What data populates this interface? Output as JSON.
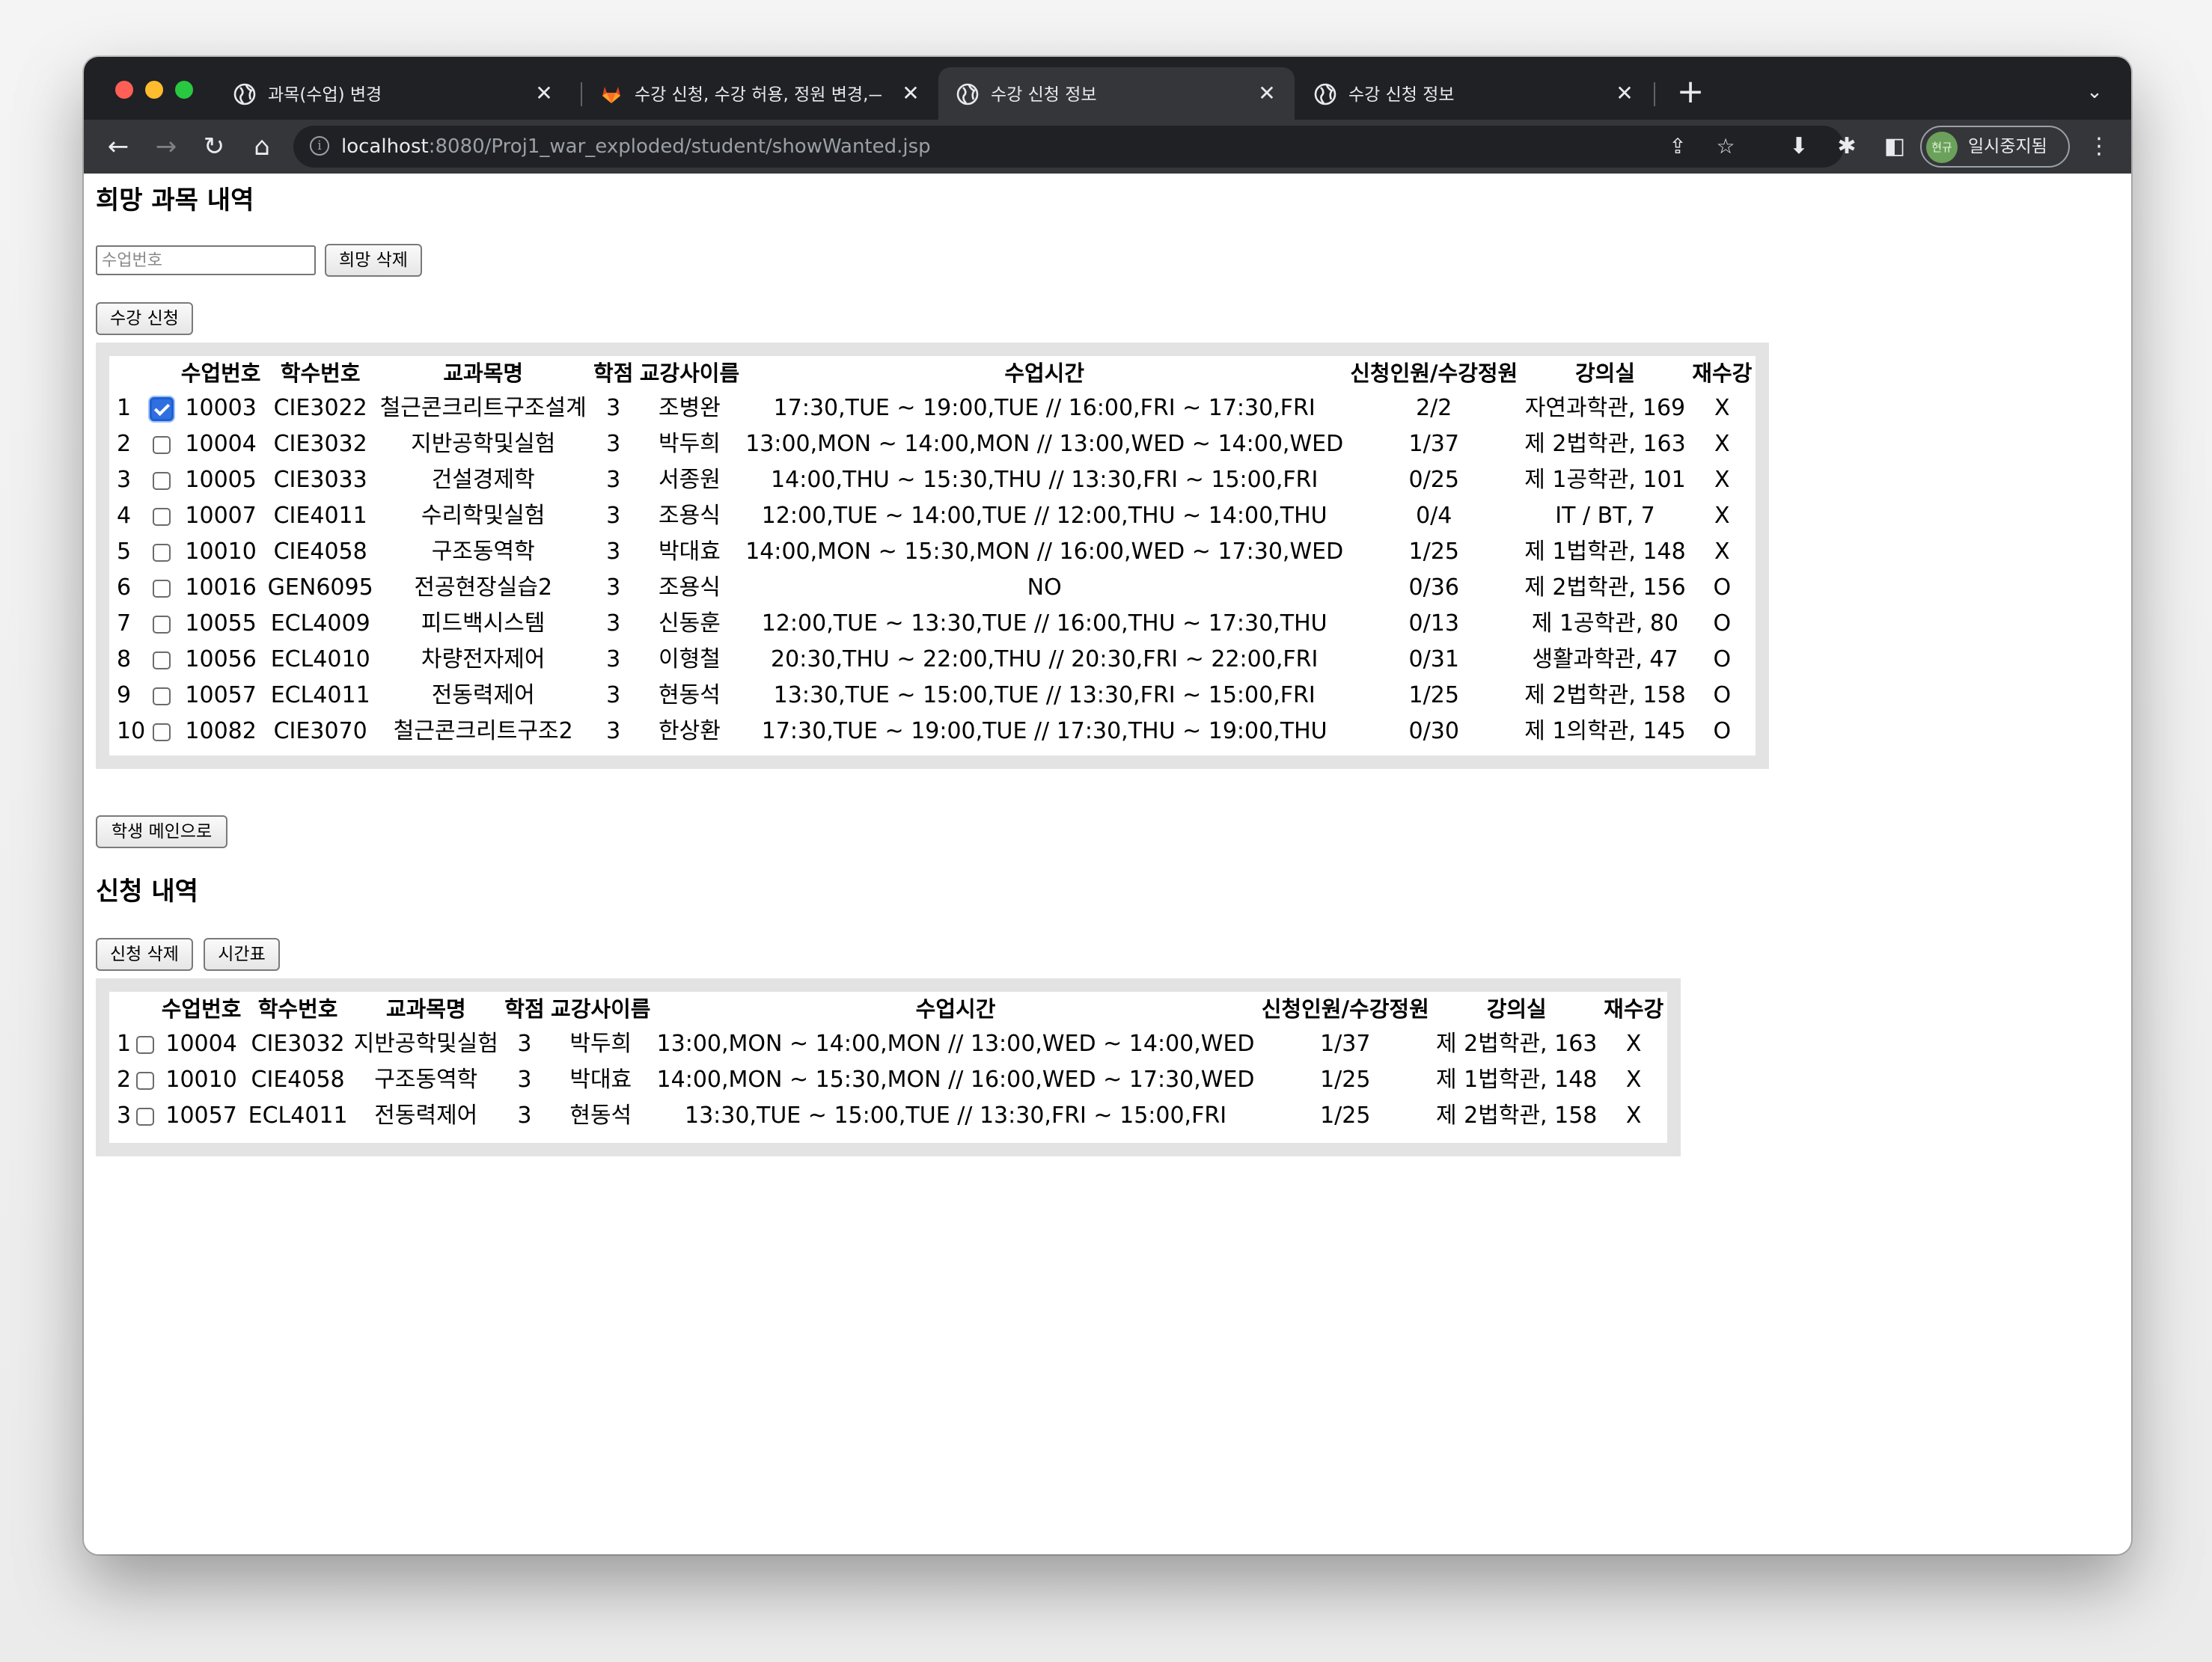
{
  "browser": {
    "tabs": [
      {
        "title": "과목(수업) 변경",
        "icon": "globe-icon",
        "active": false
      },
      {
        "title": "수강 신청, 수강 허용, 정원 변경,— 최",
        "icon": "gitlab-icon",
        "active": false
      },
      {
        "title": "수강 신청 정보",
        "icon": "globe-icon",
        "active": true
      },
      {
        "title": "수강 신청 정보",
        "icon": "globe-icon",
        "active": false
      }
    ],
    "close_glyph": "✕",
    "new_tab_glyph": "+",
    "tab_menu_glyph": "⌄",
    "url_host": "localhost",
    "url_path": ":8080/Proj1_war_exploded/student/showWanted.jsp",
    "profile_avatar_text": "현규",
    "profile_label": "일시중지됨",
    "colors": {
      "tabstrip": "#202124",
      "toolbar": "#35363a",
      "active_tab": "#35363a",
      "gitlab": "#e24329",
      "checkbox_accent": "#2f6fe0"
    }
  },
  "page": {
    "wanted_title": "희망 과목 내역",
    "course_no_placeholder": "수업번호",
    "delete_wanted_label": "희망 삭제",
    "enroll_label": "수강 신청",
    "student_main_label": "학생 메인으로",
    "applied_title": "신청 내역",
    "delete_applied_label": "신청 삭제",
    "timetable_label": "시간표"
  },
  "wanted_table": {
    "headers": {
      "course_no": "수업번호",
      "subject_no": "학수번호",
      "name": "교과목명",
      "credit": "학점",
      "instructor": "교강사이름",
      "time": "수업시간",
      "capacity": "신청인원/수강정원",
      "room": "강의실",
      "retake": "재수강"
    },
    "rows": [
      {
        "idx": "1",
        "checked": true,
        "course_no": "10003",
        "subject_no": "CIE3022",
        "name": "철근콘크리트구조설계",
        "credit": "3",
        "instructor": "조병완",
        "time": "17:30,TUE ~ 19:00,TUE // 16:00,FRI ~ 17:30,FRI",
        "capacity": "2/2",
        "room": "자연과학관, 169",
        "retake": "X"
      },
      {
        "idx": "2",
        "checked": false,
        "course_no": "10004",
        "subject_no": "CIE3032",
        "name": "지반공학및실험",
        "credit": "3",
        "instructor": "박두희",
        "time": "13:00,MON ~ 14:00,MON // 13:00,WED ~ 14:00,WED",
        "capacity": "1/37",
        "room": "제 2법학관, 163",
        "retake": "X"
      },
      {
        "idx": "3",
        "checked": false,
        "course_no": "10005",
        "subject_no": "CIE3033",
        "name": "건설경제학",
        "credit": "3",
        "instructor": "서종원",
        "time": "14:00,THU ~ 15:30,THU // 13:30,FRI ~ 15:00,FRI",
        "capacity": "0/25",
        "room": "제 1공학관, 101",
        "retake": "X"
      },
      {
        "idx": "4",
        "checked": false,
        "course_no": "10007",
        "subject_no": "CIE4011",
        "name": "수리학및실험",
        "credit": "3",
        "instructor": "조용식",
        "time": "12:00,TUE ~ 14:00,TUE // 12:00,THU ~ 14:00,THU",
        "capacity": "0/4",
        "room": "IT / BT, 7",
        "retake": "X"
      },
      {
        "idx": "5",
        "checked": false,
        "course_no": "10010",
        "subject_no": "CIE4058",
        "name": "구조동역학",
        "credit": "3",
        "instructor": "박대효",
        "time": "14:00,MON ~ 15:30,MON // 16:00,WED ~ 17:30,WED",
        "capacity": "1/25",
        "room": "제 1법학관, 148",
        "retake": "X"
      },
      {
        "idx": "6",
        "checked": false,
        "course_no": "10016",
        "subject_no": "GEN6095",
        "name": "전공현장실습2",
        "credit": "3",
        "instructor": "조용식",
        "time": "NO",
        "capacity": "0/36",
        "room": "제 2법학관, 156",
        "retake": "O"
      },
      {
        "idx": "7",
        "checked": false,
        "course_no": "10055",
        "subject_no": "ECL4009",
        "name": "피드백시스템",
        "credit": "3",
        "instructor": "신동훈",
        "time": "12:00,TUE ~ 13:30,TUE // 16:00,THU ~ 17:30,THU",
        "capacity": "0/13",
        "room": "제 1공학관, 80",
        "retake": "O"
      },
      {
        "idx": "8",
        "checked": false,
        "course_no": "10056",
        "subject_no": "ECL4010",
        "name": "차량전자제어",
        "credit": "3",
        "instructor": "이형철",
        "time": "20:30,THU ~ 22:00,THU // 20:30,FRI ~ 22:00,FRI",
        "capacity": "0/31",
        "room": "생활과학관, 47",
        "retake": "O"
      },
      {
        "idx": "9",
        "checked": false,
        "course_no": "10057",
        "subject_no": "ECL4011",
        "name": "전동력제어",
        "credit": "3",
        "instructor": "현동석",
        "time": "13:30,TUE ~ 15:00,TUE // 13:30,FRI ~ 15:00,FRI",
        "capacity": "1/25",
        "room": "제 2법학관, 158",
        "retake": "O"
      },
      {
        "idx": "10",
        "checked": false,
        "course_no": "10082",
        "subject_no": "CIE3070",
        "name": "철근콘크리트구조2",
        "credit": "3",
        "instructor": "한상환",
        "time": "17:30,TUE ~ 19:00,TUE // 17:30,THU ~ 19:00,THU",
        "capacity": "0/30",
        "room": "제 1의학관, 145",
        "retake": "O"
      }
    ]
  },
  "applied_table": {
    "headers": {
      "course_no": "수업번호",
      "subject_no": "학수번호",
      "name": "교과목명",
      "credit": "학점",
      "instructor": "교강사이름",
      "time": "수업시간",
      "capacity": "신청인원/수강정원",
      "room": "강의실",
      "retake": "재수강"
    },
    "rows": [
      {
        "idx": "1",
        "checked": false,
        "course_no": "10004",
        "subject_no": "CIE3032",
        "name": "지반공학및실험",
        "credit": "3",
        "instructor": "박두희",
        "time": "13:00,MON ~ 14:00,MON // 13:00,WED ~ 14:00,WED",
        "capacity": "1/37",
        "room": "제 2법학관, 163",
        "retake": "X"
      },
      {
        "idx": "2",
        "checked": false,
        "course_no": "10010",
        "subject_no": "CIE4058",
        "name": "구조동역학",
        "credit": "3",
        "instructor": "박대효",
        "time": "14:00,MON ~ 15:30,MON // 16:00,WED ~ 17:30,WED",
        "capacity": "1/25",
        "room": "제 1법학관, 148",
        "retake": "X"
      },
      {
        "idx": "3",
        "checked": false,
        "course_no": "10057",
        "subject_no": "ECL4011",
        "name": "전동력제어",
        "credit": "3",
        "instructor": "현동석",
        "time": "13:30,TUE ~ 15:00,TUE // 13:30,FRI ~ 15:00,FRI",
        "capacity": "1/25",
        "room": "제 2법학관, 158",
        "retake": "X"
      }
    ]
  }
}
